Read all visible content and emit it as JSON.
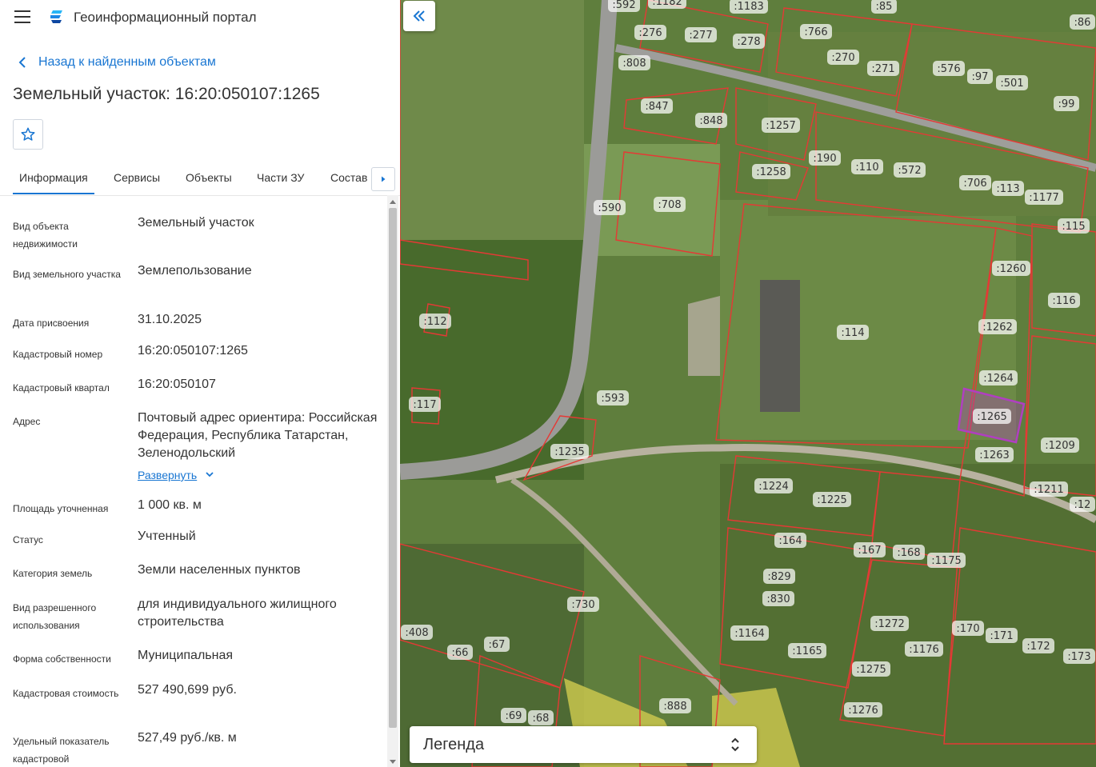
{
  "app": {
    "title": "Геоинформационный портал"
  },
  "back_link": "Назад к найденным объектам",
  "page_title": "Земельный участок: 16:20:050107:1265",
  "tabs": [
    {
      "label": "Информация"
    },
    {
      "label": "Сервисы"
    },
    {
      "label": "Объекты"
    },
    {
      "label": "Части ЗУ"
    },
    {
      "label": "Состав"
    }
  ],
  "info_rows": [
    {
      "label": "Вид объекта недвижимости",
      "value": "Земельный участок"
    },
    {
      "label": "Вид земельного участка",
      "value": "Землепользование"
    },
    {
      "label": "Дата присвоения",
      "value": "31.10.2025"
    },
    {
      "label": "Кадастровый номер",
      "value": "16:20:050107:1265"
    },
    {
      "label": "Кадастровый квартал",
      "value": "16:20:050107"
    },
    {
      "label": "Адрес",
      "value": "Почтовый адрес ориентира: Российская Федерация, Республика Татарстан, Зеленодольский"
    },
    {
      "label": "Площадь уточненная",
      "value": "1 000 кв. м"
    },
    {
      "label": "Статус",
      "value": "Учтенный"
    },
    {
      "label": "Категория земель",
      "value": "Земли населенных пунктов"
    },
    {
      "label": "Вид разрешенного использования",
      "value": "для индивидуального жилищного строительства"
    },
    {
      "label": "Форма собственности",
      "value": "Муниципальная"
    },
    {
      "label": "Кадастровая стоимость",
      "value": "527 490,699 руб."
    },
    {
      "label": "Удельный показатель кадастровой",
      "value": "527,49 руб./кв. м"
    }
  ],
  "expand_label": "Развернуть",
  "legend_label": "Легенда",
  "colors": {
    "accent": "#1976d2",
    "parcel_border": "#e53935",
    "selected_parcel": "#b03fc0",
    "zone_fill": "#e8e64a"
  },
  "icons": {
    "menu": "hamburger-icon",
    "logo": "portal-logo-icon",
    "back": "chevron-left-icon",
    "favorite": "star-icon",
    "tabs_next": "caret-right-icon",
    "collapse": "double-chevron-left-icon",
    "expand": "chevron-down-icon",
    "legend": "unfold-icon"
  },
  "map_parcels": [
    ":592",
    ":1182",
    ":1183",
    ":85",
    ":86",
    ":276",
    ":277",
    ":278",
    ":766",
    ":270",
    ":271",
    ":576",
    ":97",
    ":501",
    ":99",
    ":808",
    ":847",
    ":848",
    ":1257",
    ":190",
    ":110",
    ":572",
    ":706",
    ":113",
    ":1177",
    ":1258",
    ":590",
    ":708",
    ":115",
    ":1260",
    ":116",
    ":112",
    ":114",
    ":1262",
    ":1264",
    ":1265",
    ":117",
    ":593",
    ":1235",
    ":1209",
    ":1263",
    ":1224",
    ":1225",
    ":1211",
    ":12",
    ":164",
    ":167",
    ":168",
    ":1175",
    ":829",
    ":830",
    ":730",
    ":1272",
    ":170",
    ":171",
    ":172",
    ":173",
    ":408",
    ":66",
    ":67",
    ":1164",
    ":1165",
    ":1176",
    ":1275",
    ":69",
    ":68",
    ":888",
    ":1276"
  ]
}
